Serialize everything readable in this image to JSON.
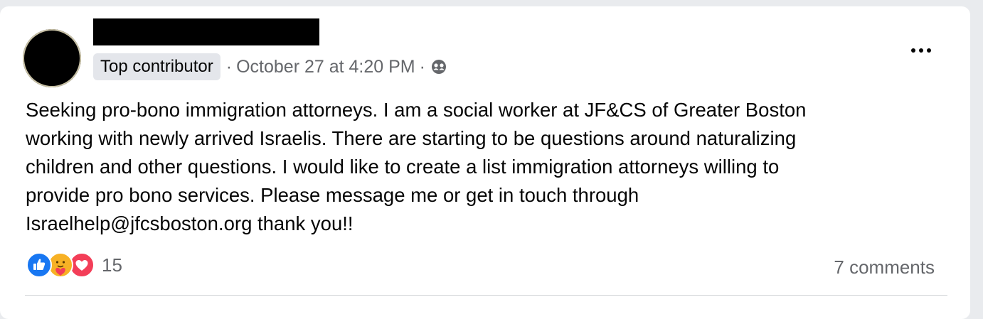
{
  "post": {
    "author_name": "",
    "badge": "Top contributor",
    "timestamp": "October 27 at 4:20 PM",
    "separator_1": "·",
    "separator_2": "·",
    "audience_icon": "group-audience-icon",
    "body": "Seeking pro-bono immigration attorneys. I am a social worker at JF&CS of Greater Boston\nworking with newly arrived Israelis. There are starting to be questions around naturalizing\nchildren and other questions. I would like to create a list immigration attorneys willing to\nprovide pro bono services. Please message me or get in touch through\nIsraelhelp@jfcsboston.org thank you!!",
    "reaction_count": "15",
    "comments_label": "7 comments",
    "reactions": [
      "like-reaction-icon",
      "care-reaction-icon",
      "love-reaction-icon"
    ]
  },
  "colors": {
    "like": "#1877f2",
    "love": "#f33e58",
    "care": "#f7b125",
    "meta_text": "#65676b"
  }
}
